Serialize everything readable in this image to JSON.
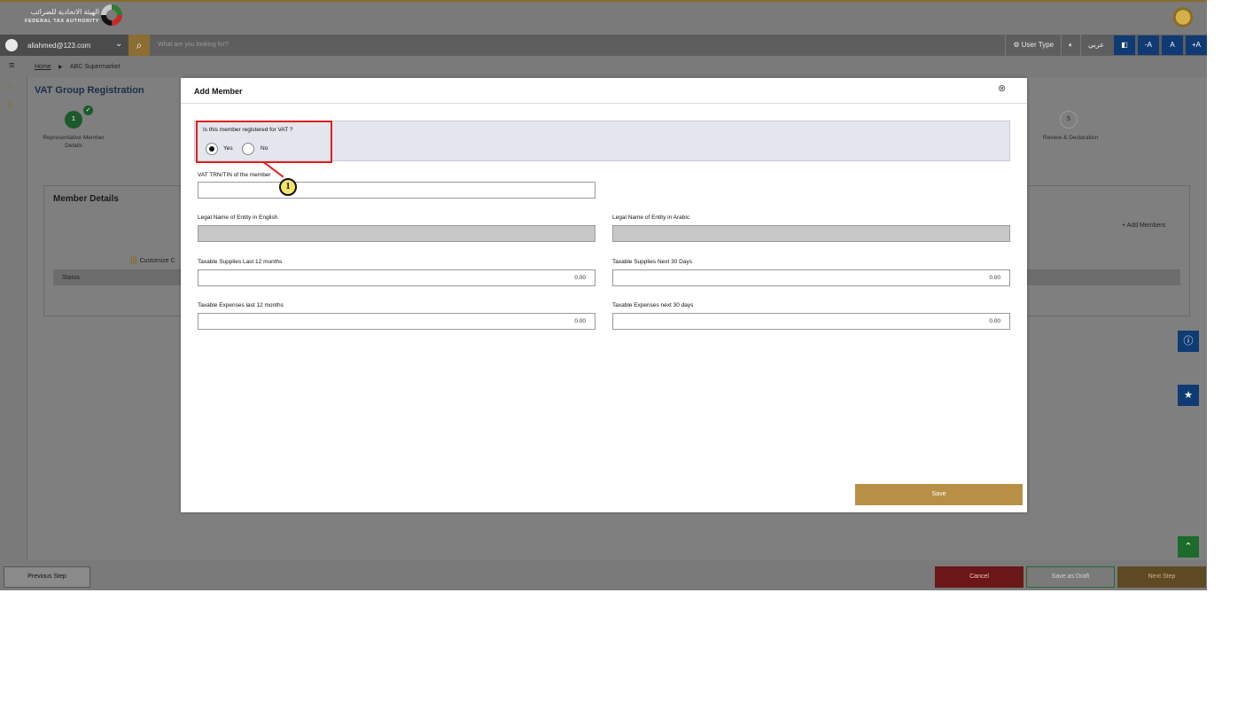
{
  "header": {
    "logo_arabic": "الهيئة الاتحادية للضرائب",
    "logo_english": "FEDERAL TAX AUTHORITY"
  },
  "navbar": {
    "user_email": "aliahmed@123.com",
    "search_placeholder": "What are you looking for?",
    "user_type": "User Type",
    "audio_icon": "speaker-icon",
    "language": "عربي",
    "font_decrease": "-A",
    "font_normal": "A",
    "font_increase": "+A"
  },
  "breadcrumb": {
    "home": "Home",
    "separator": "▶",
    "current": "ABC Supermarket"
  },
  "page": {
    "title": "VAT Group Registration",
    "steps": [
      {
        "number": "1",
        "label": "Representative Member Details",
        "status": "complete"
      },
      {
        "number": "5",
        "label": "Review & Declaration",
        "status": "pending"
      }
    ],
    "member_details": {
      "title": "Member Details",
      "add_members": "Add Members",
      "customize": "Customize C",
      "status_header": "Status"
    }
  },
  "modal": {
    "title": "Add Member",
    "question": "Is this member registered for VAT ?",
    "options": [
      {
        "label": "Yes",
        "selected": true
      },
      {
        "label": "No",
        "selected": false
      }
    ],
    "annotation_number": "1",
    "fields": {
      "trn_label": "VAT TRN/TIN of the member",
      "trn_value": "",
      "legal_name_en_label": "Legal Name of Entity in English",
      "legal_name_ar_label": "Legal Name of Entity in Arabic",
      "supplies_last_label": "Taxable Supplies Last 12 months",
      "supplies_last_value": "0.00",
      "supplies_next_label": "Taxable Supplies Next 30 Days",
      "supplies_next_value": "0.00",
      "expenses_last_label": "Taxable Expenses last 12 months",
      "expenses_last_value": "0.00",
      "expenses_next_label": "Taxable Expenses next 30 days",
      "expenses_next_value": "0.00"
    },
    "save_label": "Save"
  },
  "footer": {
    "previous": "Previous Step",
    "cancel": "Cancel",
    "save_draft": "Save as Draft",
    "next": "Next Step"
  },
  "colors": {
    "gold_accent": "#b88f45",
    "navy": "#103a73",
    "annotation_red": "#e02020",
    "annotation_yellow": "#f5e46a"
  }
}
